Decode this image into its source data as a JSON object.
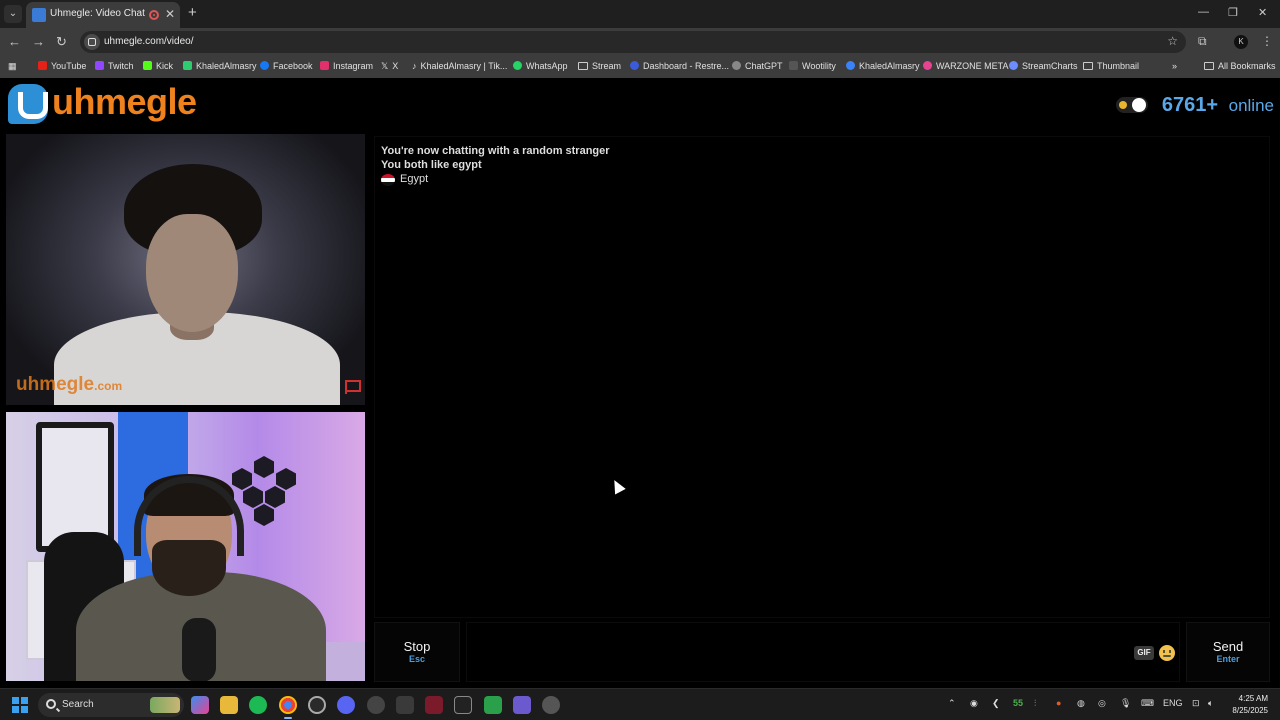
{
  "browser": {
    "tab_title": "Uhmegle: Video Chat | Ome",
    "url": "uhmegle.com/video/",
    "bookmarks": [
      {
        "label": "YouTube",
        "color": "#e62117"
      },
      {
        "label": "Twitch",
        "color": "#9146ff"
      },
      {
        "label": "Kick",
        "color": "#53fc18"
      },
      {
        "label": "KhaledAlmasry",
        "color": "#2ecc71"
      },
      {
        "label": "Facebook",
        "color": "#1877f2"
      },
      {
        "label": "Instagram",
        "color": "#e1306c"
      },
      {
        "label": "X",
        "color": "#ffffff"
      },
      {
        "label": "KhaledAlmasry | Tik...",
        "color": "#111111"
      },
      {
        "label": "WhatsApp",
        "color": "#25d366"
      },
      {
        "label": "Stream",
        "color": "folder"
      },
      {
        "label": "Dashboard - Restre...",
        "color": "#3b5bdb"
      },
      {
        "label": "ChatGPT",
        "color": "#888888"
      },
      {
        "label": "Wootility",
        "color": "#555555"
      },
      {
        "label": "KhaledAlmasry",
        "color": "#3b82f6"
      },
      {
        "label": "WARZONE META",
        "color": "#e84393"
      },
      {
        "label": "StreamCharts",
        "color": "#6c8cff"
      },
      {
        "label": "Thumbnail",
        "color": "folder"
      }
    ],
    "all_bookmarks": "All Bookmarks"
  },
  "site": {
    "logo_text": "uhmegle",
    "online_count": "6761+",
    "online_label": "online",
    "watermark_main": "uhmegle",
    "watermark_suffix": ".com"
  },
  "chat": {
    "line1": "You're now chatting with a random stranger",
    "line2": "You both like egypt",
    "country": "Egypt"
  },
  "controls": {
    "stop_label": "Stop",
    "stop_key": "Esc",
    "gif_label": "GIF",
    "send_label": "Send",
    "send_key": "Enter",
    "message_placeholder": ""
  },
  "taskbar": {
    "search_label": "Search",
    "tray_number": "55",
    "language": "ENG",
    "time": "4:25 AM",
    "date": "8/25/2025"
  }
}
